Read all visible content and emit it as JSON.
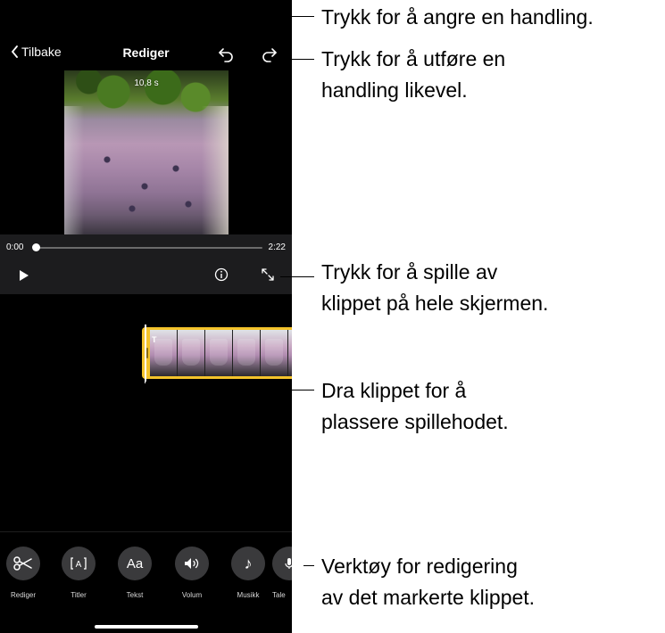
{
  "nav": {
    "back_label": "Tilbake",
    "title": "Rediger"
  },
  "preview": {
    "duration": "10,8 s"
  },
  "playback": {
    "time_start": "0:00",
    "time_end": "2:22",
    "progress": 0
  },
  "colors": {
    "accent_clip": "#f4c32b",
    "background": "#000000",
    "toolbar_button": "#3a3a3c"
  },
  "toolbar": {
    "items": [
      {
        "label": "Rediger",
        "icon": "scissors-icon"
      },
      {
        "label": "Titler",
        "icon": "title-box-icon"
      },
      {
        "label": "Tekst",
        "icon": "text-aa-icon",
        "glyph": "Aa"
      },
      {
        "label": "Volum",
        "icon": "speaker-icon"
      },
      {
        "label": "Musikk",
        "icon": "music-note-icon",
        "glyph": "♪"
      },
      {
        "label": "Tale",
        "icon": "voiceover-icon"
      }
    ]
  },
  "callouts": {
    "undo": "Trykk for å angre en handling.",
    "redo_line1": "Trykk for å utføre en",
    "redo_line2": "handling likevel.",
    "fullscreen_line1": "Trykk for å spille av",
    "fullscreen_line2": "klippet på hele skjermen.",
    "drag_line1": "Dra klippet for å",
    "drag_line2": "plassere spillehodet.",
    "tools_line1": "Verktøy for redigering",
    "tools_line2": "av det markerte klippet."
  }
}
